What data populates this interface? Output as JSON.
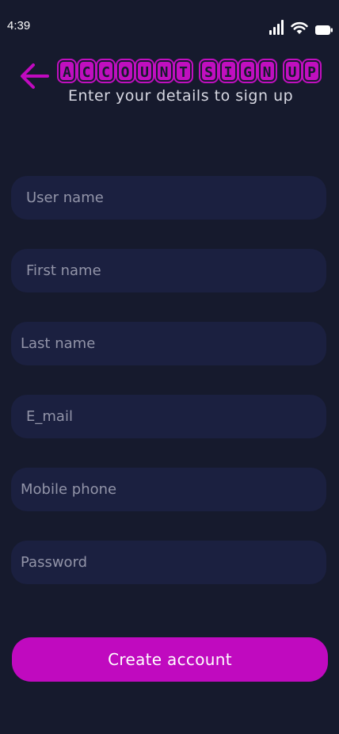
{
  "status_bar": {
    "time": "4:39"
  },
  "header": {
    "title_words": [
      [
        "A",
        "C",
        "C",
        "O",
        "U",
        "N",
        "T"
      ],
      [
        "S",
        "I",
        "G",
        "N"
      ],
      [
        "U",
        "P"
      ]
    ],
    "title": "ACCOUNT SIGN UP",
    "subtitle": "Enter your details to sign up",
    "back_icon": "arrow-left-icon"
  },
  "form": {
    "username_placeholder": "User name",
    "first_name_placeholder": "First name",
    "last_name_placeholder": "Last name",
    "email_placeholder": "E_mail",
    "mobile_placeholder": "Mobile phone",
    "password_placeholder": "Password"
  },
  "actions": {
    "create_label": "Create account"
  },
  "colors": {
    "background": "#161a2d",
    "field_background": "#1b2040",
    "accent": "#c00abf",
    "placeholder": "#9294a8"
  }
}
